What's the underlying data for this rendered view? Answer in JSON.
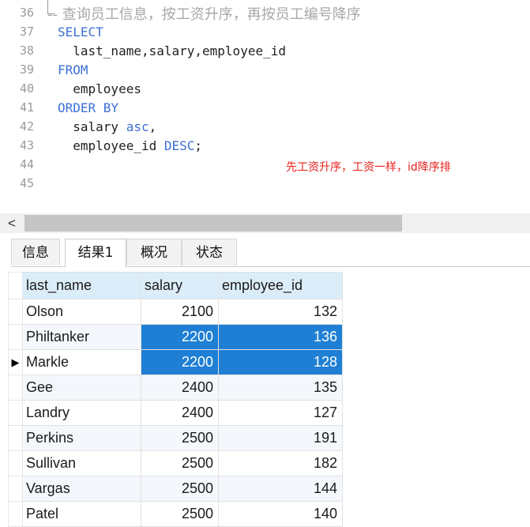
{
  "editor": {
    "lines": [
      {
        "num": "36",
        "parts": [
          {
            "t": "-- 查询员工信息，按工资升序，再按员工编号降序",
            "c": "cm"
          }
        ]
      },
      {
        "num": "37",
        "parts": [
          {
            "t": "SELECT",
            "c": "kw"
          }
        ]
      },
      {
        "num": "38",
        "parts": [
          {
            "t": "  last_name,salary,employee_id",
            "c": ""
          }
        ]
      },
      {
        "num": "39",
        "parts": [
          {
            "t": "FROM",
            "c": "kw"
          }
        ]
      },
      {
        "num": "40",
        "parts": [
          {
            "t": "  employees",
            "c": ""
          }
        ]
      },
      {
        "num": "41",
        "parts": [
          {
            "t": "ORDER BY",
            "c": "kw"
          }
        ]
      },
      {
        "num": "42",
        "parts": [
          {
            "t": "  salary ",
            "c": ""
          },
          {
            "t": "asc",
            "c": "kw"
          },
          {
            "t": ",",
            "c": ""
          }
        ]
      },
      {
        "num": "43",
        "parts": [
          {
            "t": "  employee_id ",
            "c": ""
          },
          {
            "t": "DESC",
            "c": "kw"
          },
          {
            "t": ";",
            "c": ""
          }
        ]
      },
      {
        "num": "44",
        "parts": []
      },
      {
        "num": "45",
        "parts": []
      }
    ],
    "annotation": "先工资升序，工资一样，id降序排"
  },
  "scrollbar": {
    "left_arrow": "<"
  },
  "tabs": [
    {
      "label": "信息",
      "active": false
    },
    {
      "label": "结果1",
      "active": true
    },
    {
      "label": "概况",
      "active": false
    },
    {
      "label": "状态",
      "active": false
    }
  ],
  "grid": {
    "columns": [
      "last_name",
      "salary",
      "employee_id"
    ],
    "rows": [
      {
        "last_name": "Olson",
        "salary": "2100",
        "employee_id": "132",
        "selected": false,
        "current": false
      },
      {
        "last_name": "Philtanker",
        "salary": "2200",
        "employee_id": "136",
        "selected": true,
        "current": false
      },
      {
        "last_name": "Markle",
        "salary": "2200",
        "employee_id": "128",
        "selected": true,
        "current": true
      },
      {
        "last_name": "Gee",
        "salary": "2400",
        "employee_id": "135",
        "selected": false,
        "current": false
      },
      {
        "last_name": "Landry",
        "salary": "2400",
        "employee_id": "127",
        "selected": false,
        "current": false
      },
      {
        "last_name": "Perkins",
        "salary": "2500",
        "employee_id": "191",
        "selected": false,
        "current": false
      },
      {
        "last_name": "Sullivan",
        "salary": "2500",
        "employee_id": "182",
        "selected": false,
        "current": false
      },
      {
        "last_name": "Vargas",
        "salary": "2500",
        "employee_id": "144",
        "selected": false,
        "current": false
      },
      {
        "last_name": "Patel",
        "salary": "2500",
        "employee_id": "140",
        "selected": false,
        "current": false
      }
    ],
    "current_row_marker": "▶"
  },
  "colors": {
    "keyword": "#3c6fd6",
    "annotation": "#e8221d",
    "selection": "#1e7fd4",
    "header": "#dcedfa"
  }
}
